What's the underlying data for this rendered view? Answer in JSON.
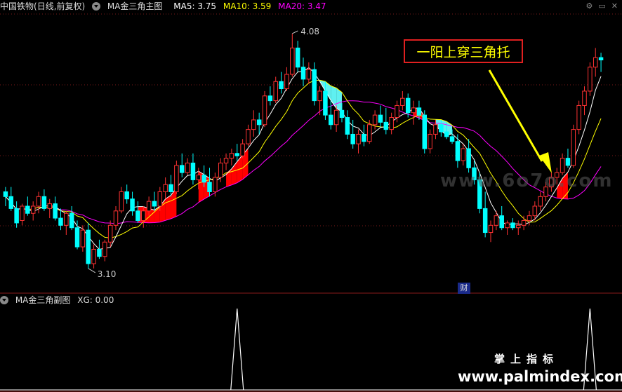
{
  "main_header": {
    "stock": "中国铁物",
    "period": "(日线,前复权)",
    "indicator": "MA金三角主图",
    "ma5": "MA5: 3.75",
    "ma10": "MA10: 3.59",
    "ma20": "MA20: 3.47"
  },
  "sub_header": {
    "indicator": "MA金三角副图",
    "xg": "XG: 0.00"
  },
  "annotation": "一阳上穿三角托",
  "high_label": "4.08",
  "low_label": "3.10",
  "finance_marker": "财",
  "watermark_main": "www.6o7o.com",
  "watermark_brand": "掌上指标",
  "watermark_url": "www.palmindex.com",
  "colors": {
    "up": "#ff3232",
    "down": "#00ffff",
    "ma5": "#ffffff",
    "ma10": "#ffff00",
    "ma20": "#ff00ff",
    "bull_fill": "#ff0000",
    "bear_fill": "#5ff0f0",
    "arrow": "#ffff00"
  },
  "chart_data": [
    {
      "type": "candlestick",
      "title": "MA金三角主图",
      "y_range": [
        3.0,
        4.15
      ],
      "candles_ohlc": [
        [
          3.42,
          3.44,
          3.36,
          3.4
        ],
        [
          3.4,
          3.44,
          3.34,
          3.35
        ],
        [
          3.35,
          3.38,
          3.27,
          3.29
        ],
        [
          3.3,
          3.37,
          3.28,
          3.36
        ],
        [
          3.36,
          3.4,
          3.32,
          3.33
        ],
        [
          3.33,
          3.38,
          3.3,
          3.36
        ],
        [
          3.36,
          3.42,
          3.33,
          3.4
        ],
        [
          3.4,
          3.43,
          3.34,
          3.35
        ],
        [
          3.35,
          3.39,
          3.31,
          3.37
        ],
        [
          3.37,
          3.4,
          3.3,
          3.31
        ],
        [
          3.31,
          3.35,
          3.26,
          3.28
        ],
        [
          3.28,
          3.34,
          3.24,
          3.33
        ],
        [
          3.33,
          3.36,
          3.26,
          3.27
        ],
        [
          3.27,
          3.3,
          3.18,
          3.19
        ],
        [
          3.19,
          3.28,
          3.17,
          3.26
        ],
        [
          3.26,
          3.29,
          3.1,
          3.12
        ],
        [
          3.12,
          3.2,
          3.1,
          3.18
        ],
        [
          3.18,
          3.22,
          3.14,
          3.15
        ],
        [
          3.15,
          3.22,
          3.13,
          3.21
        ],
        [
          3.21,
          3.3,
          3.19,
          3.28
        ],
        [
          3.28,
          3.36,
          3.26,
          3.34
        ],
        [
          3.34,
          3.44,
          3.33,
          3.42
        ],
        [
          3.42,
          3.45,
          3.37,
          3.39
        ],
        [
          3.39,
          3.42,
          3.32,
          3.34
        ],
        [
          3.34,
          3.38,
          3.29,
          3.3
        ],
        [
          3.3,
          3.36,
          3.27,
          3.34
        ],
        [
          3.34,
          3.4,
          3.32,
          3.38
        ],
        [
          3.38,
          3.42,
          3.34,
          3.36
        ],
        [
          3.36,
          3.44,
          3.34,
          3.42
        ],
        [
          3.42,
          3.48,
          3.39,
          3.45
        ],
        [
          3.45,
          3.49,
          3.4,
          3.42
        ],
        [
          3.42,
          3.55,
          3.41,
          3.53
        ],
        [
          3.53,
          3.58,
          3.48,
          3.5
        ],
        [
          3.5,
          3.56,
          3.49,
          3.54
        ],
        [
          3.54,
          3.58,
          3.45,
          3.47
        ],
        [
          3.47,
          3.52,
          3.43,
          3.49
        ],
        [
          3.49,
          3.53,
          3.44,
          3.46
        ],
        [
          3.46,
          3.52,
          3.4,
          3.42
        ],
        [
          3.42,
          3.5,
          3.4,
          3.48
        ],
        [
          3.48,
          3.56,
          3.46,
          3.54
        ],
        [
          3.54,
          3.58,
          3.51,
          3.56
        ],
        [
          3.56,
          3.6,
          3.53,
          3.58
        ],
        [
          3.58,
          3.62,
          3.55,
          3.57
        ],
        [
          3.57,
          3.64,
          3.56,
          3.62
        ],
        [
          3.62,
          3.7,
          3.61,
          3.68
        ],
        [
          3.68,
          3.76,
          3.65,
          3.72
        ],
        [
          3.72,
          3.75,
          3.66,
          3.7
        ],
        [
          3.7,
          3.84,
          3.69,
          3.82
        ],
        [
          3.82,
          3.86,
          3.78,
          3.8
        ],
        [
          3.8,
          3.9,
          3.79,
          3.88
        ],
        [
          3.88,
          3.92,
          3.83,
          3.85
        ],
        [
          3.85,
          3.94,
          3.84,
          3.91
        ],
        [
          3.91,
          4.08,
          3.9,
          4.02
        ],
        [
          4.02,
          4.05,
          3.92,
          3.94
        ],
        [
          3.94,
          3.98,
          3.86,
          3.89
        ],
        [
          3.89,
          3.96,
          3.87,
          3.93
        ],
        [
          3.93,
          3.96,
          3.78,
          3.8
        ],
        [
          3.8,
          3.86,
          3.74,
          3.84
        ],
        [
          3.84,
          3.88,
          3.72,
          3.74
        ],
        [
          3.74,
          3.8,
          3.68,
          3.7
        ],
        [
          3.7,
          3.78,
          3.67,
          3.76
        ],
        [
          3.76,
          3.79,
          3.71,
          3.73
        ],
        [
          3.73,
          3.76,
          3.64,
          3.66
        ],
        [
          3.66,
          3.72,
          3.6,
          3.62
        ],
        [
          3.62,
          3.68,
          3.58,
          3.66
        ],
        [
          3.66,
          3.7,
          3.61,
          3.63
        ],
        [
          3.63,
          3.72,
          3.62,
          3.7
        ],
        [
          3.7,
          3.76,
          3.68,
          3.74
        ],
        [
          3.74,
          3.78,
          3.69,
          3.71
        ],
        [
          3.71,
          3.77,
          3.66,
          3.68
        ],
        [
          3.68,
          3.75,
          3.66,
          3.73
        ],
        [
          3.73,
          3.8,
          3.71,
          3.78
        ],
        [
          3.78,
          3.84,
          3.76,
          3.81
        ],
        [
          3.81,
          3.83,
          3.73,
          3.75
        ],
        [
          3.75,
          3.8,
          3.7,
          3.77
        ],
        [
          3.77,
          3.8,
          3.72,
          3.74
        ],
        [
          3.74,
          3.76,
          3.58,
          3.6
        ],
        [
          3.6,
          3.68,
          3.58,
          3.66
        ],
        [
          3.66,
          3.72,
          3.64,
          3.7
        ],
        [
          3.7,
          3.72,
          3.65,
          3.67
        ],
        [
          3.67,
          3.7,
          3.64,
          3.65
        ],
        [
          3.65,
          3.68,
          3.62,
          3.63
        ],
        [
          3.63,
          3.66,
          3.52,
          3.55
        ],
        [
          3.55,
          3.62,
          3.53,
          3.6
        ],
        [
          3.6,
          3.64,
          3.5,
          3.52
        ],
        [
          3.52,
          3.55,
          3.45,
          3.47
        ],
        [
          3.47,
          3.5,
          3.33,
          3.35
        ],
        [
          3.35,
          3.42,
          3.23,
          3.25
        ],
        [
          3.25,
          3.3,
          3.21,
          3.28
        ],
        [
          3.28,
          3.34,
          3.26,
          3.32
        ],
        [
          3.32,
          3.36,
          3.26,
          3.27
        ],
        [
          3.27,
          3.3,
          3.24,
          3.29
        ],
        [
          3.29,
          3.31,
          3.26,
          3.27
        ],
        [
          3.27,
          3.3,
          3.24,
          3.28
        ],
        [
          3.28,
          3.32,
          3.26,
          3.3
        ],
        [
          3.3,
          3.34,
          3.28,
          3.32
        ],
        [
          3.32,
          3.38,
          3.3,
          3.36
        ],
        [
          3.36,
          3.42,
          3.34,
          3.4
        ],
        [
          3.4,
          3.46,
          3.38,
          3.44
        ],
        [
          3.44,
          3.5,
          3.42,
          3.48
        ],
        [
          3.48,
          3.52,
          3.45,
          3.5
        ],
        [
          3.5,
          3.58,
          3.49,
          3.56
        ],
        [
          3.56,
          3.6,
          3.52,
          3.53
        ],
        [
          3.53,
          3.7,
          3.52,
          3.68
        ],
        [
          3.68,
          3.8,
          3.66,
          3.78
        ],
        [
          3.78,
          3.86,
          3.74,
          3.84
        ],
        [
          3.84,
          3.96,
          3.82,
          3.94
        ],
        [
          3.94,
          4.02,
          3.9,
          3.98
        ],
        [
          3.98,
          4.0,
          3.92,
          3.97
        ]
      ]
    },
    {
      "type": "line",
      "title": "MA金三角副图",
      "series": [
        {
          "name": "XG",
          "values": [
            0,
            0,
            0,
            0,
            0,
            0,
            0,
            0,
            0,
            0,
            0,
            0,
            0,
            0,
            0,
            0,
            0,
            0,
            0,
            0,
            0,
            0,
            0,
            0,
            0,
            0,
            0,
            0,
            0,
            0,
            0,
            0,
            0,
            0,
            0,
            0,
            0,
            0,
            0,
            0,
            0,
            0,
            1,
            0,
            0,
            0,
            0,
            0,
            0,
            0,
            0,
            0,
            0,
            0,
            0,
            0,
            0,
            0,
            0,
            0,
            0,
            0,
            0,
            0,
            0,
            0,
            0,
            0,
            0,
            0,
            0,
            0,
            0,
            0,
            0,
            0,
            0,
            0,
            0,
            0,
            0,
            0,
            0,
            0,
            0,
            0,
            0,
            0,
            0,
            0,
            0,
            0,
            0,
            0,
            0,
            0,
            0,
            0,
            0,
            0,
            0,
            0,
            0,
            0,
            0,
            0,
            1,
            0,
            0,
            0,
            0
          ]
        }
      ],
      "ylim": [
        0,
        1
      ]
    }
  ]
}
